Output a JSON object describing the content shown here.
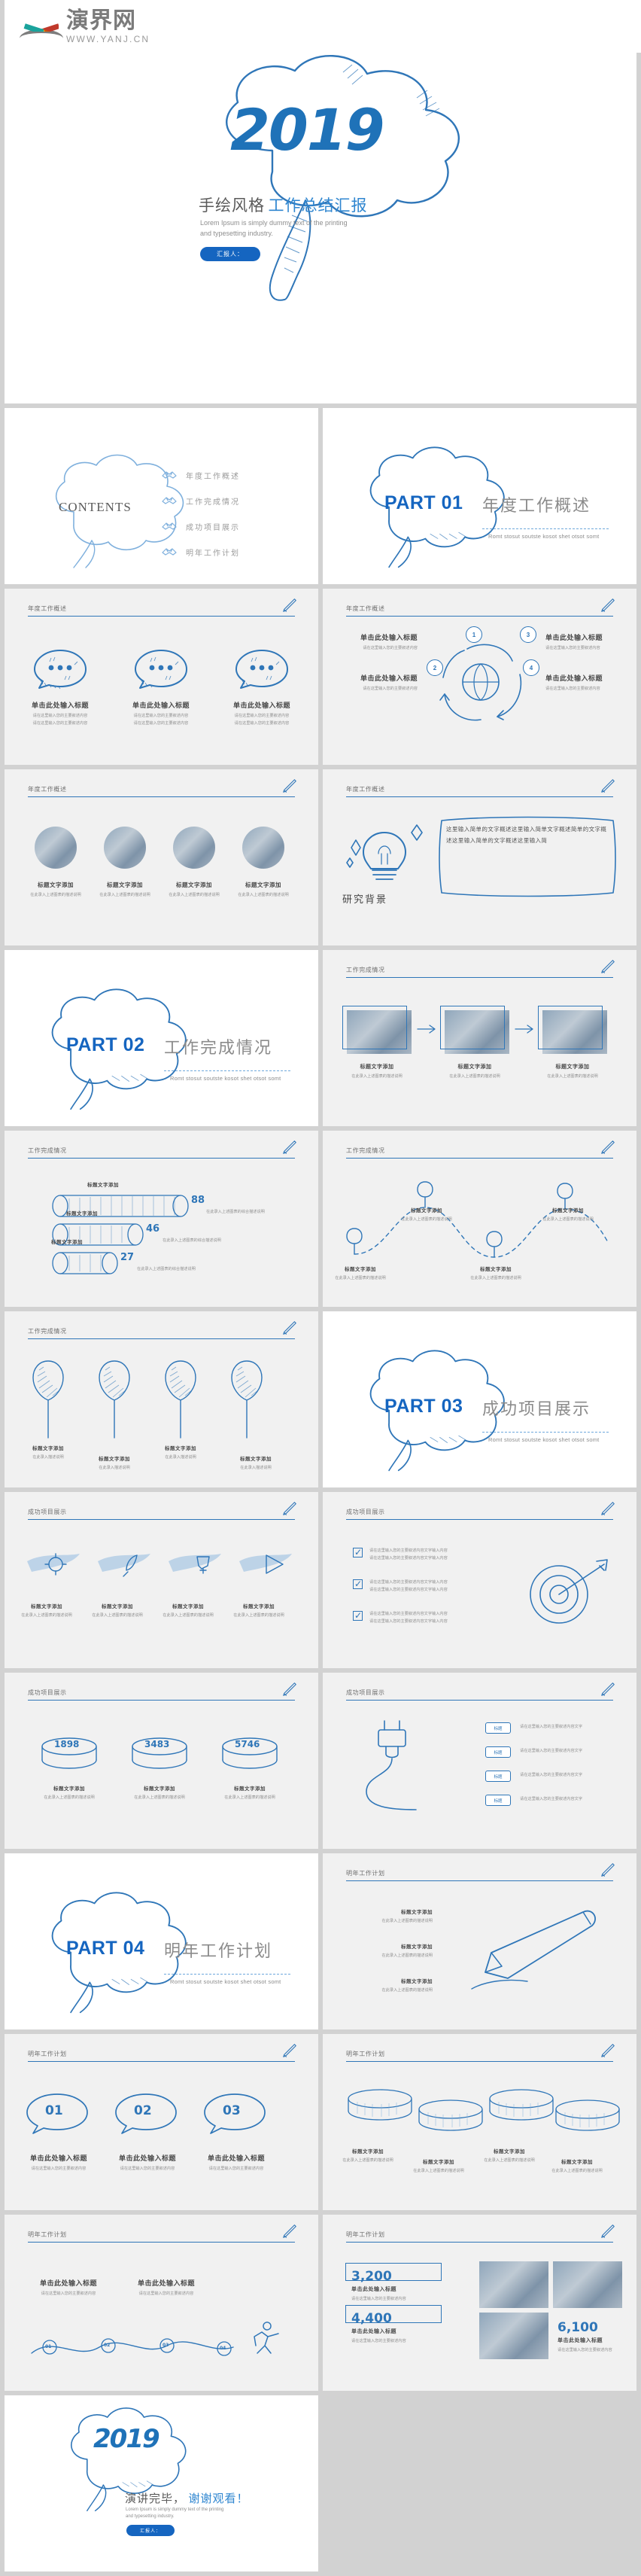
{
  "brand": {
    "name_cn": "演界网",
    "url": "WWW.YANJ.CN",
    "logo_icon": "fan-logo-icon"
  },
  "cover": {
    "year": "2019",
    "title_dark": "手绘风格",
    "title_blue": "工作总结汇报",
    "subtitle_line1": "Lorem Ipsum is simply dummy text of the printing",
    "subtitle_line2": "and typesetting industry.",
    "button": "汇报人："
  },
  "contents": {
    "word": "CONTENTS",
    "icon": "handshake-icon",
    "items": [
      {
        "label": "年度工作概述"
      },
      {
        "label": "工作完成情况"
      },
      {
        "label": "成功项目展示"
      },
      {
        "label": "明年工作计划"
      }
    ]
  },
  "parts": [
    {
      "id": "PART 01",
      "cn": "年度工作概述",
      "sub": "Romt stosut soutste kosot shet otsot somt"
    },
    {
      "id": "PART 02",
      "cn": "工作完成情况",
      "sub": "Romt stosut soutste kosot shet otsot somt"
    },
    {
      "id": "PART 03",
      "cn": "成功项目展示",
      "sub": "Romt stosut soutste kosot shet otsot somt"
    },
    {
      "id": "PART 04",
      "cn": "明年工作计划",
      "sub": "Romt stosut soutste kosot shet otsot somt"
    }
  ],
  "section_headers": {
    "overview": "年度工作概述",
    "completion": "工作完成情况",
    "projects": "成功项目展示",
    "nextyear": "明年工作计划",
    "pencil_icon": "pencil-icon"
  },
  "common": {
    "heading": "单击此处输入标题",
    "body_line": "请在这里输入您的主要叙述内容",
    "text_title": "标题文字添加",
    "text_title_here": "在此录入上述图表的综合描述说明",
    "bubble_icon": "speech-bubble-icon"
  },
  "slide_bubbles": {
    "items": [
      {
        "title": "单击此处输入标题",
        "line1": "请在这里输入您的主要叙述内容",
        "line2": "请在这里输入您的主要叙述内容"
      },
      {
        "title": "单击此处输入标题",
        "line1": "请在这里输入您的主要叙述内容",
        "line2": "请在这里输入您的主要叙述内容"
      },
      {
        "title": "单击此处输入标题",
        "line1": "请在这里输入您的主要叙述内容",
        "line2": "请在这里输入您的主要叙述内容"
      }
    ]
  },
  "slide_cycle": {
    "numbers": [
      "1",
      "2",
      "3",
      "4"
    ],
    "icon": "handshake-globe-icon",
    "left_items": [
      {
        "title": "单击此处输入标题",
        "line": "请在这里输入您的主要叙述内容"
      },
      {
        "title": "单击此处输入标题",
        "line": "请在这里输入您的主要叙述内容"
      }
    ],
    "right_items": [
      {
        "title": "单击此处输入标题",
        "line": "请在这里输入您的主要叙述内容"
      },
      {
        "title": "单击此处输入标题",
        "line": "请在这里输入您的主要叙述内容"
      }
    ]
  },
  "slide_photos4": {
    "items": [
      {
        "title": "标题文字添加",
        "line": "在此录入上述图表的描述说明"
      },
      {
        "title": "标题文字添加",
        "line": "在此录入上述图表的描述说明"
      },
      {
        "title": "标题文字添加",
        "line": "在此录入上述图表的描述说明"
      },
      {
        "title": "标题文字添加",
        "line": "在此录入上述图表的描述说明"
      }
    ]
  },
  "slide_research": {
    "label": "研究背景",
    "bulb_icon": "lightbulb-icon",
    "text": "这里输入简单的文字概述这里输入简单文字概述简单的文字概述这里输入简单的文字概述这里输入简"
  },
  "slide_photorow": {
    "items": [
      {
        "title": "标题文字添加",
        "line": "在此录入上述图表的描述说明"
      },
      {
        "title": "标题文字添加",
        "line": "在此录入上述图表的描述说明"
      },
      {
        "title": "标题文字添加",
        "line": "在此录入上述图表的描述说明"
      }
    ]
  },
  "chart_data": {
    "type": "bar",
    "title": "工作完成情况",
    "categories": [
      "标题文字添加",
      "标题文字添加",
      "标题文字添加"
    ],
    "values": [
      88,
      46,
      27
    ],
    "value_labels": [
      "88",
      "46",
      "27"
    ],
    "ylabel": "",
    "xlabel": "",
    "ylim": [
      0,
      100
    ],
    "note": "横向立体柱形进度条（手绘圆柱样式）"
  },
  "slide_route": {
    "stops": [
      {
        "title": "标题文字添加",
        "line": "在此录入上述图表的描述说明"
      },
      {
        "title": "标题文字添加",
        "line": "在此录入上述图表的描述说明"
      },
      {
        "title": "标题文字添加",
        "line": "在此录入上述图表的描述说明"
      },
      {
        "title": "标题文字添加",
        "line": "在此录入上述图表的描述说明"
      }
    ],
    "pin_icon": "map-pin-icon"
  },
  "slide_balloons": {
    "items": [
      {
        "title": "标题文字添加",
        "line": "在此录入描述说明"
      },
      {
        "title": "标题文字添加",
        "line": "在此录入描述说明"
      },
      {
        "title": "标题文字添加",
        "line": "在此录入描述说明"
      },
      {
        "title": "标题文字添加",
        "line": "在此录入描述说明"
      }
    ],
    "icon": "balloon-icon"
  },
  "slide_brush4": {
    "icons": [
      "gear-icon",
      "rocket-icon",
      "trophy-icon",
      "play-icon"
    ],
    "items": [
      {
        "title": "标题文字添加",
        "line": "在此录入上述图表的描述说明"
      },
      {
        "title": "标题文字添加",
        "line": "在此录入上述图表的描述说明"
      },
      {
        "title": "标题文字添加",
        "line": "在此录入上述图表的描述说明"
      },
      {
        "title": "标题文字添加",
        "line": "在此录入上述图表的描述说明"
      }
    ]
  },
  "slide_checklist": {
    "target_icon": "target-icon",
    "items": [
      {
        "line1": "请在这里输入您的主要叙述内容文字输入内容",
        "line2": "请在这里输入您的主要叙述内容文字输入内容"
      },
      {
        "line1": "请在这里输入您的主要叙述内容文字输入内容",
        "line2": "请在这里输入您的主要叙述内容文字输入内容"
      },
      {
        "line1": "请在这里输入您的主要叙述内容文字输入内容",
        "line2": "请在这里输入您的主要叙述内容文字输入内容"
      }
    ]
  },
  "slide_stats": {
    "items": [
      {
        "value": "1898",
        "title": "标题文字添加",
        "line": "在此录入上述图表的描述说明"
      },
      {
        "value": "3483",
        "title": "标题文字添加",
        "line": "在此录入上述图表的描述说明"
      },
      {
        "value": "5746",
        "title": "标题文字添加",
        "line": "在此录入上述图表的描述说明"
      }
    ]
  },
  "slide_plug": {
    "plug_icon": "plug-icon",
    "tags": [
      "标题",
      "标题",
      "标题",
      "标题"
    ],
    "rows": [
      {
        "text": "请在这里输入您的主要叙述内容文字"
      },
      {
        "text": "请在这里输入您的主要叙述内容文字"
      },
      {
        "text": "请在这里输入您的主要叙述内容文字"
      },
      {
        "text": "请在这里输入您的主要叙述内容文字"
      }
    ]
  },
  "slide_pencil_big": {
    "pencil_icon": "big-pencil-icon",
    "left_items": [
      {
        "title": "标题文字添加",
        "line": "在此录入上述图表的描述说明"
      },
      {
        "title": "标题文字添加",
        "line": "在此录入上述图表的描述说明"
      },
      {
        "title": "标题文字添加",
        "line": "在此录入上述图表的描述说明"
      }
    ]
  },
  "slide_123": {
    "items": [
      {
        "num": "01",
        "title": "单击此处输入标题",
        "line": "请在这里输入您的主要叙述内容"
      },
      {
        "num": "02",
        "title": "单击此处输入标题",
        "line": "请在这里输入您的主要叙述内容"
      },
      {
        "num": "03",
        "title": "单击此处输入标题",
        "line": "请在这里输入您的主要叙述内容"
      }
    ]
  },
  "slide_cyl4": {
    "items": [
      {
        "title": "标题文字添加",
        "line": "在此录入上述图表的描述说明"
      },
      {
        "title": "标题文字添加",
        "line": "在此录入上述图表的描述说明"
      },
      {
        "title": "标题文字添加",
        "line": "在此录入上述图表的描述说明"
      },
      {
        "title": "标题文字添加",
        "line": "在此录入上述图表的描述说明"
      }
    ]
  },
  "slide_runner": {
    "milestones": [
      "01",
      "02",
      "03",
      "04"
    ],
    "runner_icon": "runner-icon",
    "items": [
      {
        "title": "单击此处输入标题",
        "line": "请在这里输入您的主要叙述内容"
      },
      {
        "title": "单击此处输入标题",
        "line": "请在这里输入您的主要叙述内容"
      }
    ]
  },
  "slide_bignum": {
    "items": [
      {
        "value": "3,200",
        "title": "单击此处输入标题",
        "line": "请在这里输入您的主要叙述内容"
      },
      {
        "value": "4,400",
        "title": "单击此处输入标题",
        "line": "请在这里输入您的主要叙述内容"
      },
      {
        "value": "6,100",
        "title": "单击此处输入标题",
        "line": "请在这里输入您的主要叙述内容"
      }
    ]
  },
  "ending": {
    "year": "2019",
    "title_dark": "演讲完毕，",
    "title_blue": "谢谢观看！",
    "subtitle_line1": "Lorem Ipsum is simply dummy text of the printing",
    "subtitle_line2": "and typesetting industry.",
    "button": "汇报人："
  },
  "colors": {
    "accent": "#2f76b8",
    "accent_dark": "#1565c0",
    "text_gray": "#8b8b8b",
    "slide_gray": "#f1f1f1",
    "page_bg": "#d2d2d2"
  }
}
